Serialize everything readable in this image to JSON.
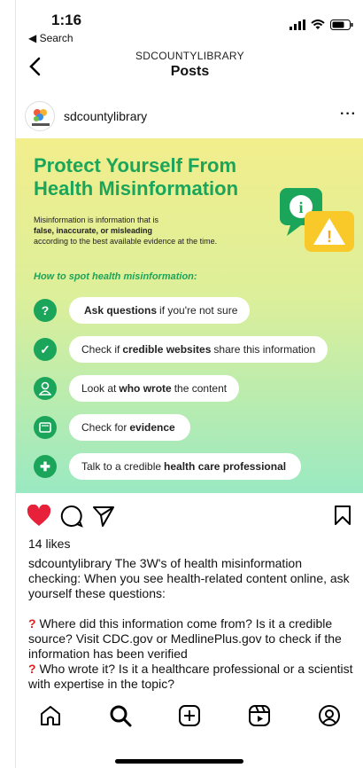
{
  "status": {
    "time": "1:16",
    "back_app": "◀ Search"
  },
  "nav": {
    "subtitle": "SDCOUNTYLIBRARY",
    "title": "Posts"
  },
  "post": {
    "username": "sdcountylibrary",
    "image": {
      "title": "Protect Yourself From Health Misinformation",
      "desc_line1": "Misinformation is information that is",
      "desc_bold": "false, inaccurate, or misleading",
      "desc_line3": "according to the best available evidence at the time.",
      "subheading": "How to spot health misinformation:",
      "tips": [
        {
          "pre": "",
          "bold": "Ask questions",
          "post": "if you're not sure"
        },
        {
          "pre": "Check if",
          "bold": "credible websites",
          "post": "share this information"
        },
        {
          "pre": "Look at",
          "bold": "who wrote",
          "post": "the content"
        },
        {
          "pre": "Check for",
          "bold": "evidence",
          "post": ""
        },
        {
          "pre": "Talk to a credible",
          "bold": "health care professional",
          "post": ""
        }
      ]
    },
    "likes": "14 likes",
    "caption": {
      "user": "sdcountylibrary",
      "text": " The 3W's of health misinformation checking: When you see health-related content online, ask yourself these questions:",
      "q1": " Where did this information come from? Is it a credible source? Visit CDC.gov or MedlinePlus.gov to check if the information has been verified",
      "q2": " Who wrote it? Is it a healthcare professional or a scientist with expertise in the topic?"
    }
  },
  "colors": {
    "brand_green": "#1aa55a",
    "like_red": "#e8213a"
  }
}
